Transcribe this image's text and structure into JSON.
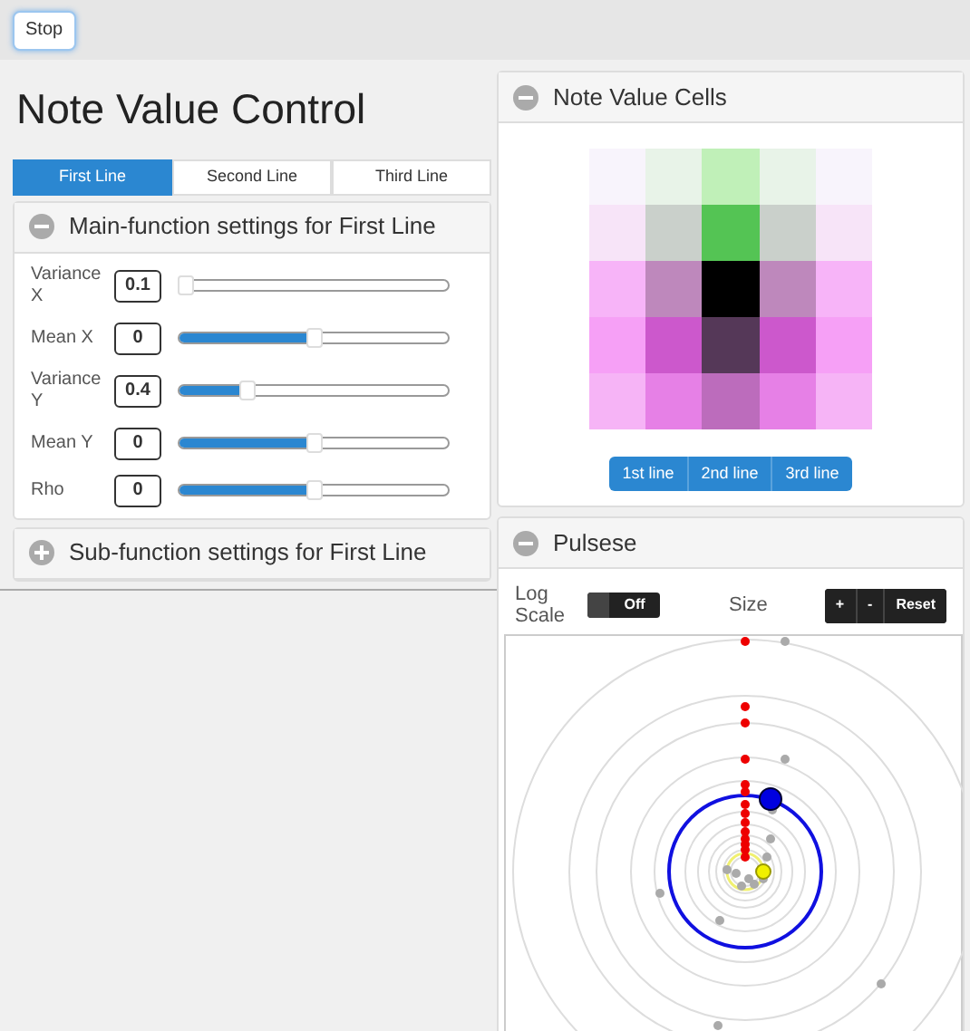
{
  "toolbar": {
    "stop_button": "Stop"
  },
  "title": "Note Value Control",
  "tabs": [
    {
      "label": "First Line",
      "selected": true
    },
    {
      "label": "Second Line",
      "selected": false
    },
    {
      "label": "Third Line",
      "selected": false
    }
  ],
  "main_panel": {
    "title": "Main-function settings for First Line",
    "expanded": true,
    "params": [
      {
        "label": "Variance X",
        "value": "0.1",
        "level": 0.02
      },
      {
        "label": "Mean X",
        "value": "0",
        "level": 0.5
      },
      {
        "label": "Variance Y",
        "value": "0.4",
        "level": 0.25
      },
      {
        "label": "Mean Y",
        "value": "0",
        "level": 0.5
      },
      {
        "label": "Rho",
        "value": "0",
        "level": 0.5
      }
    ]
  },
  "sub_panel": {
    "title": "Sub-function settings for First Line",
    "expanded": false
  },
  "cells_panel": {
    "title": "Note Value Cells",
    "expanded": true,
    "cells": [
      {
        "color": "#f8f4fc"
      },
      {
        "color": "#e8f3e8"
      },
      {
        "color": "#c0f0b8"
      },
      {
        "color": "#e8f3e8"
      },
      {
        "color": "#f8f4fc"
      },
      {
        "color": "#f7e4f8"
      },
      {
        "color": "#cad0cb"
      },
      {
        "color": "#54c454"
      },
      {
        "color": "#cad0cb"
      },
      {
        "color": "#f7e4f8"
      },
      {
        "color": "#f7b4f8"
      },
      {
        "color": "#be88bc"
      },
      {
        "color": "#000000"
      },
      {
        "color": "#be88bc"
      },
      {
        "color": "#f7b4f8"
      },
      {
        "color": "#f6a0f6"
      },
      {
        "color": "#cc58cc"
      },
      {
        "color": "#553858"
      },
      {
        "color": "#cc58cc"
      },
      {
        "color": "#f6a0f6"
      },
      {
        "color": "#f6b4f6"
      },
      {
        "color": "#e680e6"
      },
      {
        "color": "#bc6cbc"
      },
      {
        "color": "#e680e6"
      },
      {
        "color": "#f6b4f6"
      }
    ],
    "line_buttons": [
      "1st line",
      "2nd line",
      "3rd line"
    ]
  },
  "pulse_panel": {
    "title": "Pulsese",
    "expanded": true,
    "log_scale": {
      "label": "Log Scale",
      "on": false,
      "state_text": "Off"
    },
    "size_label": "Size",
    "size_buttons": [
      "+",
      "-",
      "Reset"
    ]
  }
}
